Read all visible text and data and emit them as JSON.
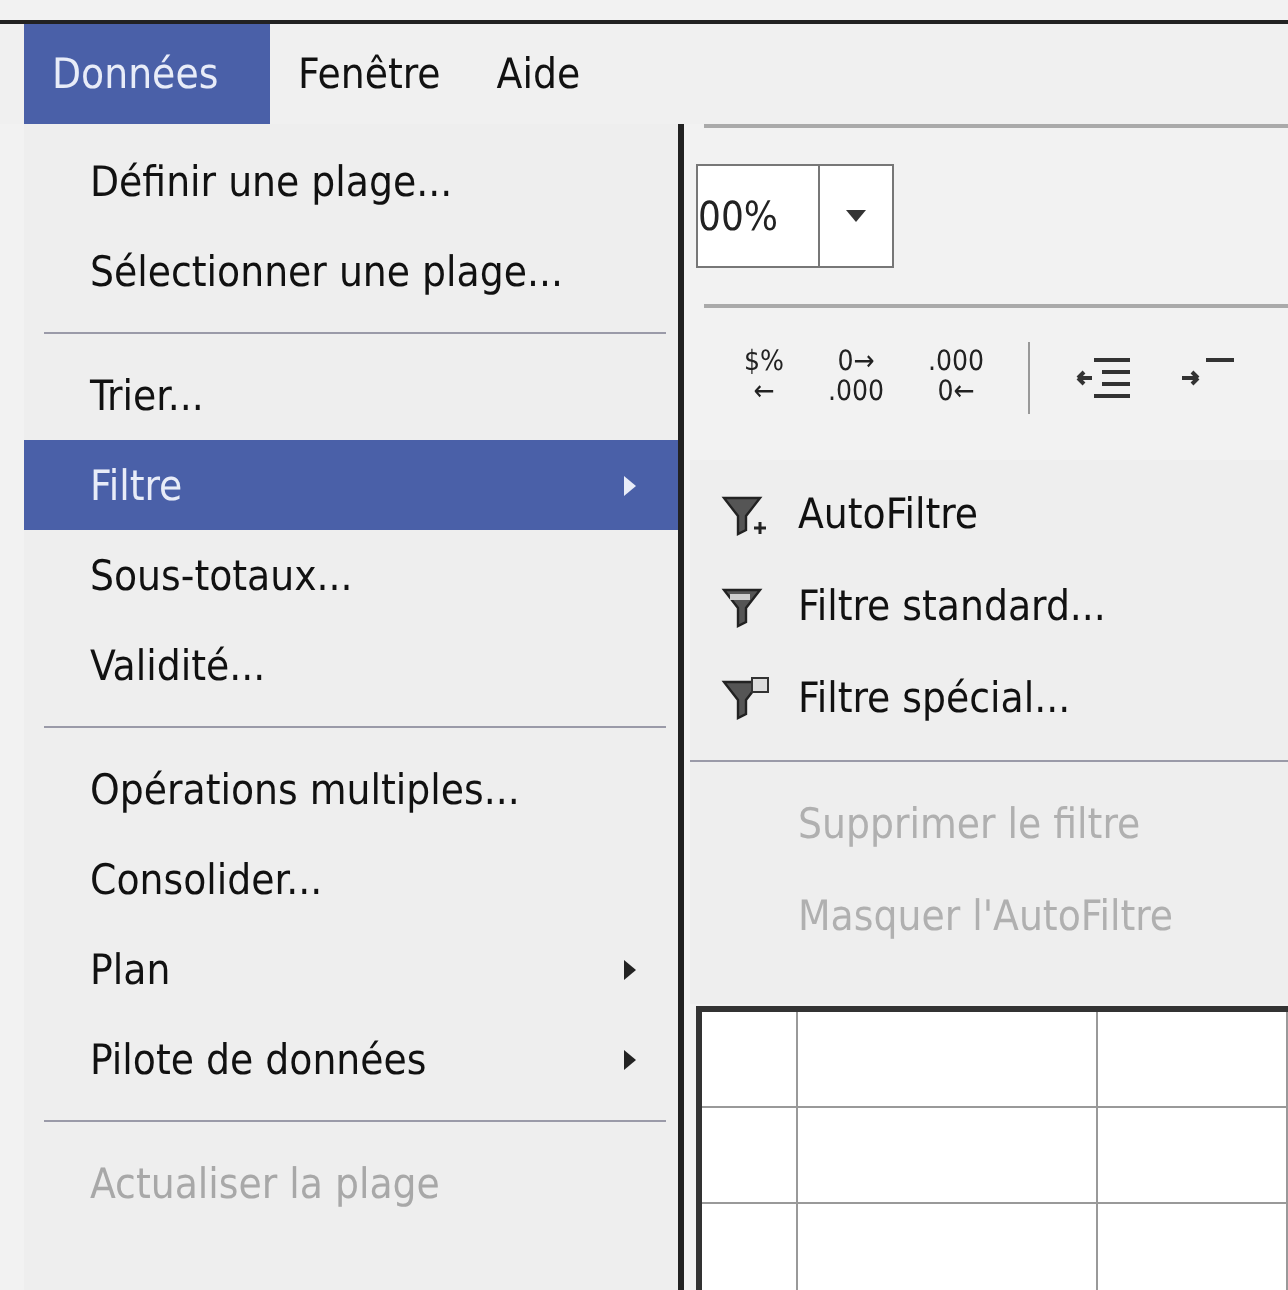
{
  "menubar": [
    {
      "label": "Données",
      "selected": true
    },
    {
      "label": "Fenêtre",
      "selected": false
    },
    {
      "label": "Aide",
      "selected": false
    }
  ],
  "zoom": {
    "value": "00%"
  },
  "toolbar": [
    {
      "kind": "text",
      "top": "$%",
      "bottom": "←"
    },
    {
      "kind": "text",
      "top": "0→",
      "bottom": ".000"
    },
    {
      "kind": "text",
      "top": ".000",
      "bottom": "0←"
    },
    {
      "kind": "indent-left"
    },
    {
      "kind": "indent-right"
    }
  ],
  "menu": [
    {
      "kind": "item",
      "label": "Définir une plage...",
      "selected": false,
      "disabled": false,
      "submenu": false
    },
    {
      "kind": "item",
      "label": "Sélectionner une plage...",
      "selected": false,
      "disabled": false,
      "submenu": false
    },
    {
      "kind": "separator"
    },
    {
      "kind": "item",
      "label": "Trier...",
      "selected": false,
      "disabled": false,
      "submenu": false
    },
    {
      "kind": "item",
      "label": "Filtre",
      "selected": true,
      "disabled": false,
      "submenu": true
    },
    {
      "kind": "item",
      "label": "Sous-totaux...",
      "selected": false,
      "disabled": false,
      "submenu": false
    },
    {
      "kind": "item",
      "label": "Validité...",
      "selected": false,
      "disabled": false,
      "submenu": false
    },
    {
      "kind": "separator"
    },
    {
      "kind": "item",
      "label": "Opérations multiples...",
      "selected": false,
      "disabled": false,
      "submenu": false
    },
    {
      "kind": "item",
      "label": "Consolider...",
      "selected": false,
      "disabled": false,
      "submenu": false
    },
    {
      "kind": "item",
      "label": "Plan",
      "selected": false,
      "disabled": false,
      "submenu": true
    },
    {
      "kind": "item",
      "label": "Pilote de données",
      "selected": false,
      "disabled": false,
      "submenu": true
    },
    {
      "kind": "separator"
    },
    {
      "kind": "item",
      "label": "Actualiser la plage",
      "selected": false,
      "disabled": true,
      "submenu": false
    }
  ],
  "submenu": [
    {
      "kind": "funnel",
      "label": "AutoFiltre",
      "disabled": false
    },
    {
      "kind": "funnel",
      "label": "Filtre standard...",
      "disabled": false
    },
    {
      "kind": "funnel",
      "label": "Filtre spécial...",
      "disabled": false
    },
    {
      "kind": "separator"
    },
    {
      "kind": "plain",
      "label": "Supprimer le filtre",
      "disabled": true
    },
    {
      "kind": "plain",
      "label": "Masquer l'AutoFiltre",
      "disabled": true
    }
  ]
}
